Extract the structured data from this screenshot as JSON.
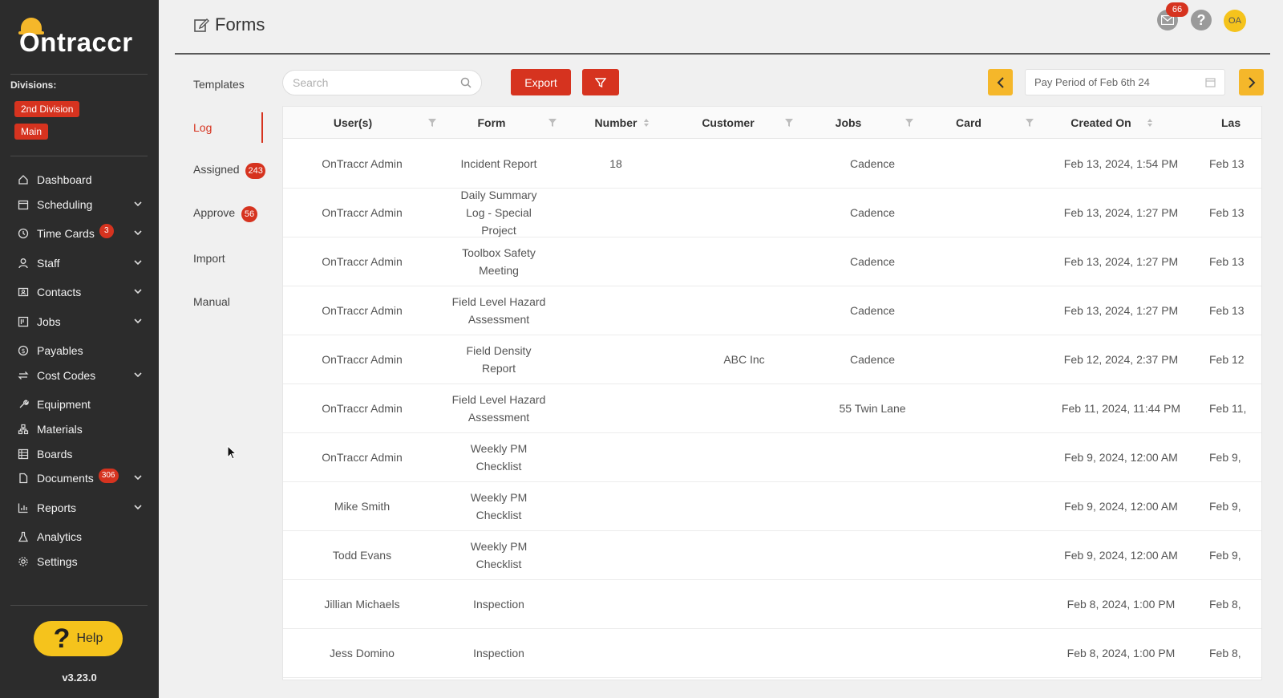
{
  "app": {
    "name": "Ontraccr",
    "version": "v3.23.0"
  },
  "sidebar": {
    "divisions_label": "Divisions:",
    "divisions": [
      "2nd Division",
      "Main"
    ],
    "items": [
      {
        "label": "Dashboard",
        "icon": "home-icon",
        "expandable": false,
        "badge": ""
      },
      {
        "label": "Scheduling",
        "icon": "calendar-icon",
        "expandable": true,
        "badge": ""
      },
      {
        "label": "Time Cards",
        "icon": "clock-icon",
        "expandable": true,
        "badge": "3"
      },
      {
        "label": "Staff",
        "icon": "user-icon",
        "expandable": true,
        "badge": ""
      },
      {
        "label": "Contacts",
        "icon": "contacts-icon",
        "expandable": true,
        "badge": ""
      },
      {
        "label": "Jobs",
        "icon": "project-icon",
        "expandable": true,
        "badge": ""
      },
      {
        "label": "Payables",
        "icon": "dollar-icon",
        "expandable": false,
        "badge": ""
      },
      {
        "label": "Cost Codes",
        "icon": "swap-icon",
        "expandable": true,
        "badge": ""
      },
      {
        "label": "Equipment",
        "icon": "tool-icon",
        "expandable": false,
        "badge": ""
      },
      {
        "label": "Materials",
        "icon": "cluster-icon",
        "expandable": false,
        "badge": ""
      },
      {
        "label": "Boards",
        "icon": "board-icon",
        "expandable": false,
        "badge": ""
      },
      {
        "label": "Documents",
        "icon": "file-icon",
        "expandable": true,
        "badge": "306"
      },
      {
        "label": "Reports",
        "icon": "chart-icon",
        "expandable": true,
        "badge": ""
      },
      {
        "label": "Analytics",
        "icon": "experiment-icon",
        "expandable": false,
        "badge": ""
      },
      {
        "label": "Settings",
        "icon": "gear-icon",
        "expandable": false,
        "badge": ""
      }
    ],
    "help_label": "Help"
  },
  "header": {
    "title": "Forms",
    "notifications_count": "66",
    "avatar_initials": "OA"
  },
  "subnav": {
    "items": [
      {
        "label": "Templates",
        "badge": ""
      },
      {
        "label": "Log",
        "badge": ""
      },
      {
        "label": "Assigned",
        "badge": "243"
      },
      {
        "label": "Approve",
        "badge": "56"
      },
      {
        "label": "Import",
        "badge": ""
      },
      {
        "label": "Manual",
        "badge": ""
      }
    ],
    "active": "Log"
  },
  "toolbar": {
    "search_placeholder": "Search",
    "export_label": "Export",
    "period_label": "Pay Period of Feb 6th 24"
  },
  "table": {
    "columns": [
      "User(s)",
      "Form",
      "Number",
      "Customer",
      "Jobs",
      "Card",
      "Created On",
      "Las"
    ],
    "rows": [
      {
        "user": "OnTraccr Admin",
        "form": "Incident Report",
        "number": "18",
        "customer": "",
        "jobs": "Cadence",
        "card": "",
        "created": "Feb 13, 2024, 1:54 PM",
        "last": "Feb 13"
      },
      {
        "user": "OnTraccr Admin",
        "form": "Daily Summary Log - Special Project",
        "number": "",
        "customer": "",
        "jobs": "Cadence",
        "card": "",
        "created": "Feb 13, 2024, 1:27 PM",
        "last": "Feb 13"
      },
      {
        "user": "OnTraccr Admin",
        "form": "Toolbox Safety Meeting",
        "number": "",
        "customer": "",
        "jobs": "Cadence",
        "card": "",
        "created": "Feb 13, 2024, 1:27 PM",
        "last": "Feb 13"
      },
      {
        "user": "OnTraccr Admin",
        "form": "Field Level Hazard Assessment",
        "number": "",
        "customer": "",
        "jobs": "Cadence",
        "card": "",
        "created": "Feb 13, 2024, 1:27 PM",
        "last": "Feb 13"
      },
      {
        "user": "OnTraccr Admin",
        "form": "Field Density Report",
        "number": "",
        "customer": "ABC Inc",
        "jobs": "Cadence",
        "card": "",
        "created": "Feb 12, 2024, 2:37 PM",
        "last": "Feb 12"
      },
      {
        "user": "OnTraccr Admin",
        "form": "Field Level Hazard Assessment",
        "number": "",
        "customer": "",
        "jobs": "55 Twin Lane",
        "card": "",
        "created": "Feb 11, 2024, 11:44 PM",
        "last": "Feb 11,"
      },
      {
        "user": "OnTraccr Admin",
        "form": "Weekly PM Checklist",
        "number": "",
        "customer": "",
        "jobs": "",
        "card": "",
        "created": "Feb 9, 2024, 12:00 AM",
        "last": "Feb 9,"
      },
      {
        "user": "Mike Smith",
        "form": "Weekly PM Checklist",
        "number": "",
        "customer": "",
        "jobs": "",
        "card": "",
        "created": "Feb 9, 2024, 12:00 AM",
        "last": "Feb 9,"
      },
      {
        "user": "Todd Evans",
        "form": "Weekly PM Checklist",
        "number": "",
        "customer": "",
        "jobs": "",
        "card": "",
        "created": "Feb 9, 2024, 12:00 AM",
        "last": "Feb 9,"
      },
      {
        "user": "Jillian Michaels",
        "form": "Inspection",
        "number": "",
        "customer": "",
        "jobs": "",
        "card": "",
        "created": "Feb 8, 2024, 1:00 PM",
        "last": "Feb 8,"
      },
      {
        "user": "Jess Domino",
        "form": "Inspection",
        "number": "",
        "customer": "",
        "jobs": "",
        "card": "",
        "created": "Feb 8, 2024, 1:00 PM",
        "last": "Feb 8,"
      }
    ]
  },
  "colors": {
    "sidebar_bg": "#2c2c2c",
    "accent_red": "#d6331f",
    "accent_yellow": "#f5b72a",
    "help_yellow": "#f5c31c"
  }
}
